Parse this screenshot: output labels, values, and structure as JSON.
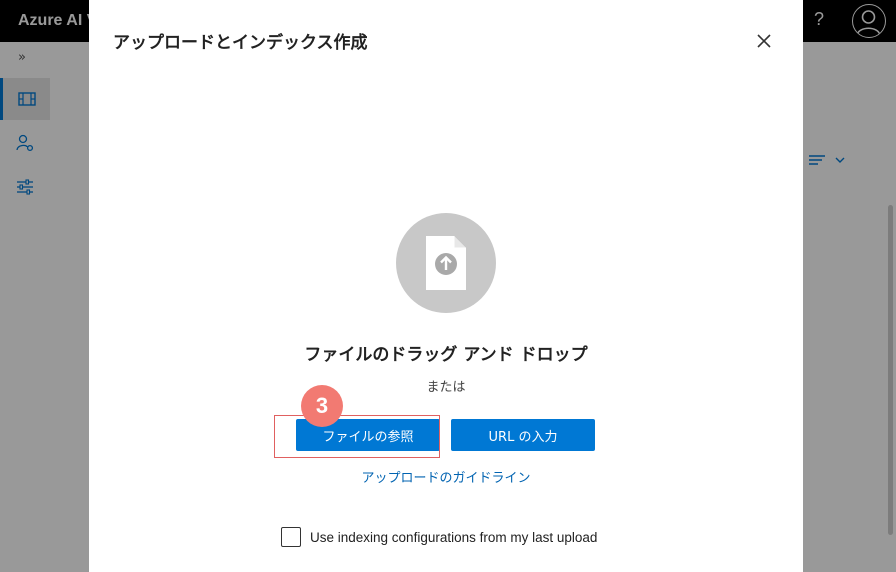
{
  "app": {
    "title": "Azure AI V",
    "help_glyph": "?"
  },
  "nav": {
    "expand_glyph": "»",
    "items": [
      {
        "icon": "film-icon",
        "active": true
      },
      {
        "icon": "person-gear-icon",
        "active": false
      },
      {
        "icon": "sliders-icon",
        "active": false
      }
    ]
  },
  "dialog": {
    "title": "アップロードとインデックス作成",
    "close_glyph": "×",
    "drop_title": "ファイルのドラッグ アンド ドロップ",
    "or_text": "または",
    "browse_button": "ファイルの参照",
    "url_button": "URL の入力",
    "guideline_link": "アップロードのガイドライン",
    "checkbox_label": "Use indexing configurations from my last upload",
    "checkbox_checked": false
  },
  "annotation": {
    "step_number": "3",
    "badge_color": "#f27a72",
    "box_color": "#e06060"
  },
  "colors": {
    "accent": "#0078d4",
    "link": "#0063b1",
    "topbar": "#000000"
  }
}
